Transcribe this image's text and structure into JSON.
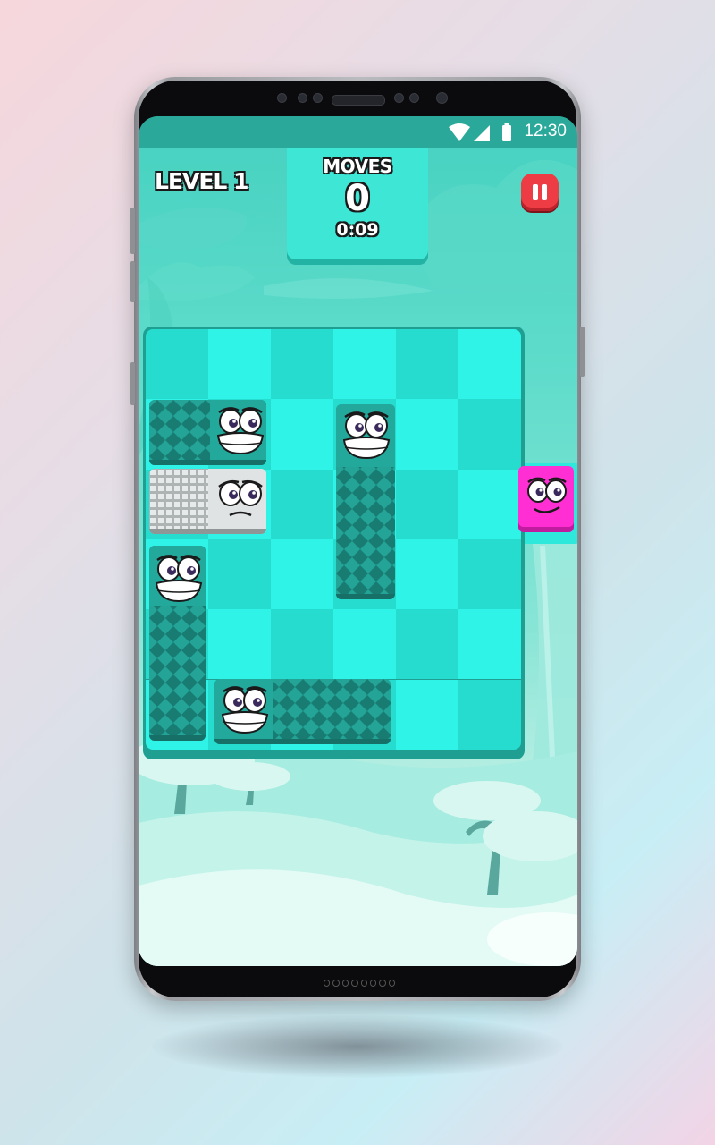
{
  "status_bar": {
    "time": "12:30",
    "wifi_icon": "wifi-icon",
    "signal_icon": "signal-icon",
    "battery_icon": "battery-icon"
  },
  "hud": {
    "level_label": "LEVEL 1",
    "moves_title": "MOVES",
    "moves_count": "0",
    "timer": "0:09",
    "pause_icon": "pause-icon"
  },
  "board": {
    "columns": 6,
    "rows": 6,
    "exit_row": 3,
    "blocks": [
      {
        "id": "teal-horizontal-top",
        "color": "teal",
        "orientation": "horizontal",
        "row": 2,
        "col": 1,
        "length": 2,
        "face": "grin"
      },
      {
        "id": "grey-horizontal",
        "color": "grey",
        "orientation": "horizontal",
        "row": 3,
        "col": 1,
        "length": 2,
        "face": "worried"
      },
      {
        "id": "teal-vertical-left",
        "color": "teal",
        "orientation": "vertical",
        "row": 4,
        "col": 1,
        "length": 3,
        "face": "grin"
      },
      {
        "id": "teal-vertical-center",
        "color": "teal",
        "orientation": "vertical",
        "row": 2,
        "col": 4,
        "length": 3,
        "face": "grin"
      },
      {
        "id": "teal-horizontal-bottom",
        "color": "teal",
        "orientation": "horizontal",
        "row": 6,
        "col": 2,
        "length": 3,
        "face": "grin"
      },
      {
        "id": "pink-target",
        "color": "pink",
        "orientation": "single",
        "row": 3,
        "col": 7,
        "length": 1,
        "face": "smile"
      }
    ]
  },
  "colors": {
    "screen_bg": "#46d1c0",
    "board_light": "#2ef3e6",
    "board_dark": "#25dccf",
    "teal_block": "#1e8f86",
    "grey_block": "#d9dcdc",
    "pink_block": "#ff2fd4",
    "pause_button": "#ee3c44"
  }
}
